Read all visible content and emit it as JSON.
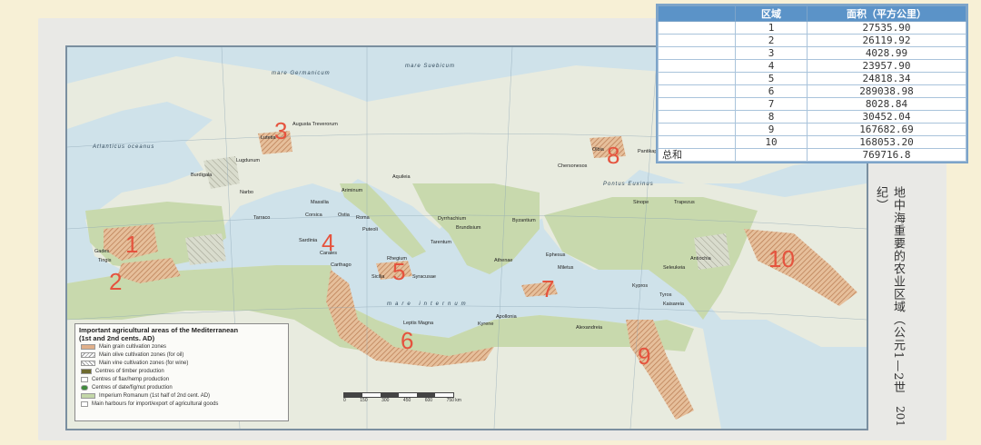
{
  "table": {
    "header_region": "区域",
    "header_area": "面积（平方公里）",
    "rows": [
      {
        "region": "1",
        "area": "27535.90"
      },
      {
        "region": "2",
        "area": "26119.92"
      },
      {
        "region": "3",
        "area": "4028.99"
      },
      {
        "region": "4",
        "area": "23957.90"
      },
      {
        "region": "5",
        "area": "24818.34"
      },
      {
        "region": "6",
        "area": "289038.98"
      },
      {
        "region": "7",
        "area": "8028.84"
      },
      {
        "region": "8",
        "area": "30452.04"
      },
      {
        "region": "9",
        "area": "167682.69"
      },
      {
        "region": "10",
        "area": "168053.20"
      }
    ],
    "total_label": "总和",
    "total_value": "769716.8"
  },
  "markers": [
    "1",
    "2",
    "3",
    "4",
    "5",
    "6",
    "7",
    "8",
    "9",
    "10"
  ],
  "legend": {
    "title_line1": "Important agricultural areas of the Mediterranean",
    "title_line2": "(1st and 2nd cents. AD)",
    "items": [
      "Main grain cultivation zones",
      "Main olive cultivation zones (for oil)",
      "Main vine cultivation zones (for wine)",
      "Centres of timber production",
      "Centres of flax/hemp production",
      "Centres of date/fig/nut production",
      "Imperium Romanum (1st half of 2nd cent. AD)",
      "Main harbours for import/export of agricultural goods"
    ]
  },
  "scale_ticks": [
    "0",
    "150",
    "300",
    "450",
    "600",
    "750 km"
  ],
  "sea_labels": {
    "germanicum": "mare Germanicum",
    "suebicum": "mare Suebicum",
    "atlanticus": "Atlanticus oceanus",
    "internum": "mare internum",
    "euxinus": "Pontus Euxinus"
  },
  "cities": {
    "augusta": "Augusta Treverorum",
    "lutetia": "Lutetia",
    "lugdunum": "Lugdunum",
    "burdigala": "Burdigala",
    "narbo": "Narbo",
    "tarraco": "Tarraco",
    "massilia": "Massilia",
    "aquileia": "Aquileia",
    "ariminum": "Ariminum",
    "corsica": "Corsica",
    "ostia": "Ostia",
    "roma": "Roma",
    "puteoli": "Puteoli",
    "sardinia": "Sardinia",
    "carales": "Carales",
    "carthago": "Carthago",
    "sicilia": "Sicilia",
    "syracusae": "Syracusae",
    "rhegium": "Rhegium",
    "tarentum": "Tarentum",
    "brundisium": "Brundisium",
    "dyrrhachium": "Dyrrhachium",
    "byzantium": "Byzantium",
    "ephesus": "Ephesus",
    "athenae": "Athenae",
    "miletus": "Miletus",
    "sinope": "Sinope",
    "trapezus": "Trapezus",
    "seleukeia": "Seleukeia",
    "antiochia": "Antiochia",
    "kypros": "Kypros",
    "tyros": "Tyros",
    "kaisareia": "Kaisareia",
    "alexandreia": "Alexandreia",
    "apollonia": "Apollonia",
    "kyrene": "Kyrene",
    "leptis": "Leptis Magna",
    "gades": "Gades",
    "tingis": "Tingis",
    "olbia": "Olbia",
    "chersonesos": "Chersonesos",
    "pantikapaion": "Pantikapaion"
  },
  "side_title": "地中海重要的农业区域（公元1—2世纪）",
  "page_no": "201",
  "colors": {
    "marker": "#e5533e",
    "table_header": "#5b93c8",
    "sea": "#cfe2ea",
    "land": "#e8ebdf",
    "empire": "#c3d7a8",
    "grain": "#e0b08a"
  }
}
